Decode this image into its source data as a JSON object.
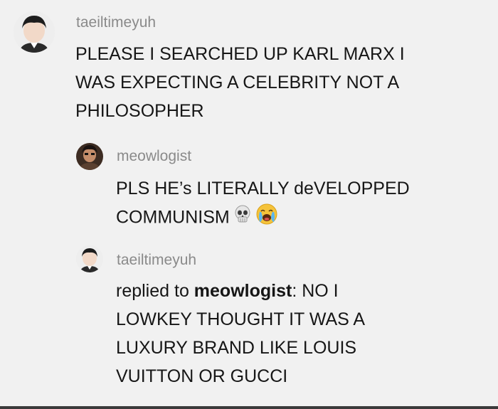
{
  "comments": [
    {
      "username": "taeiltimeyuh",
      "lines": [
        "PLEASE I SEARCHED UP KARL MARX I",
        "WAS EXPECTING A CELEBRITY NOT A",
        "PHILOSOPHER"
      ]
    },
    {
      "username": "meowlogist",
      "lines": [
        "PLS HE’s LITERALLY deVELOPPED",
        "COMMUNISM"
      ]
    },
    {
      "username": "taeiltimeyuh",
      "reply_prefix": "replied to ",
      "reply_to": "meowlogist",
      "reply_rest": ": NO I",
      "lines": [
        "LOWKEY THOUGHT IT WAS A",
        "LUXURY BRAND LIKE LOUIS",
        "VUITTON OR GUCCI"
      ]
    }
  ],
  "icons": {
    "skull": "skull-emoji",
    "crying": "loudly-crying-face-emoji"
  }
}
